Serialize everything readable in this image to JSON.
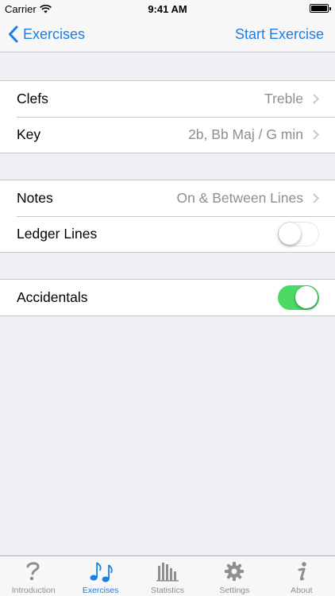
{
  "status": {
    "carrier": "Carrier",
    "time": "9:41 AM"
  },
  "nav": {
    "back_label": "Exercises",
    "action_label": "Start Exercise"
  },
  "sections": [
    {
      "rows": [
        {
          "label": "Clefs",
          "value": "Treble"
        },
        {
          "label": "Key",
          "value": "2b, Bb Maj / G min"
        }
      ]
    },
    {
      "rows": [
        {
          "label": "Notes",
          "value": "On & Between Lines"
        },
        {
          "label": "Ledger Lines",
          "toggle": false
        }
      ]
    },
    {
      "rows": [
        {
          "label": "Accidentals",
          "toggle": true
        }
      ]
    }
  ],
  "tabs": [
    {
      "label": "Introduction",
      "icon": "question-mark-icon",
      "active": false
    },
    {
      "label": "Exercises",
      "icon": "music-notes-icon",
      "active": true
    },
    {
      "label": "Statistics",
      "icon": "bar-chart-icon",
      "active": false
    },
    {
      "label": "Settings",
      "icon": "gear-icon",
      "active": false
    },
    {
      "label": "About",
      "icon": "info-icon",
      "active": false
    }
  ],
  "colors": {
    "accent": "#1a7fe6",
    "toggle_on": "#4cd964",
    "secondary_text": "#8e8e93"
  }
}
